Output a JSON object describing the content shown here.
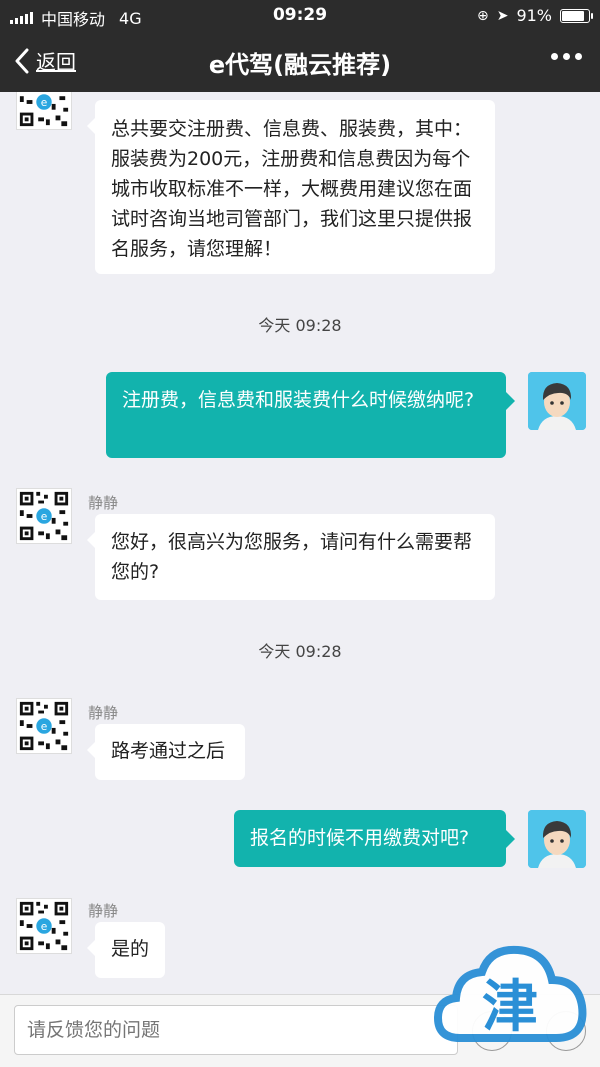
{
  "status_bar": {
    "carrier": "中国移动",
    "network": "4G",
    "time": "09:29",
    "battery": "91%",
    "battery_level": 0.91
  },
  "nav": {
    "back_label": "返回",
    "title": "e代驾(融云推荐)"
  },
  "messages": [
    {
      "direction": "in",
      "text": "总共要交注册费、信息费、服装费，其中：服装费为200元，注册费和信息费因为每个城市收取标准不一样，大概费用建议您在面试时咨询当地司管部门，我们这里只提供报名服务，请您理解！"
    },
    {
      "type": "time",
      "text": "今天 09:28"
    },
    {
      "direction": "out",
      "text": "注册费，信息费和服装费什么时候缴纳呢?"
    },
    {
      "direction": "in",
      "sender": "静静",
      "text": "您好，很高兴为您服务，请问有什么需要帮您的?"
    },
    {
      "type": "time",
      "text": "今天 09:28"
    },
    {
      "direction": "in",
      "sender": "静静",
      "text": "路考通过之后"
    },
    {
      "direction": "out",
      "text": "报名的时候不用缴费对吧?"
    },
    {
      "direction": "in",
      "sender": "静静",
      "text": "是的"
    }
  ],
  "input": {
    "placeholder": "请反馈您的问题"
  },
  "watermark": {
    "text": "津"
  },
  "colors": {
    "nav_bg": "#2c2c2c",
    "outgoing_bubble": "#12b3ad",
    "incoming_bubble": "#ffffff",
    "chat_bg": "#efeff4",
    "watermark_blue": "#2a8fd6"
  }
}
